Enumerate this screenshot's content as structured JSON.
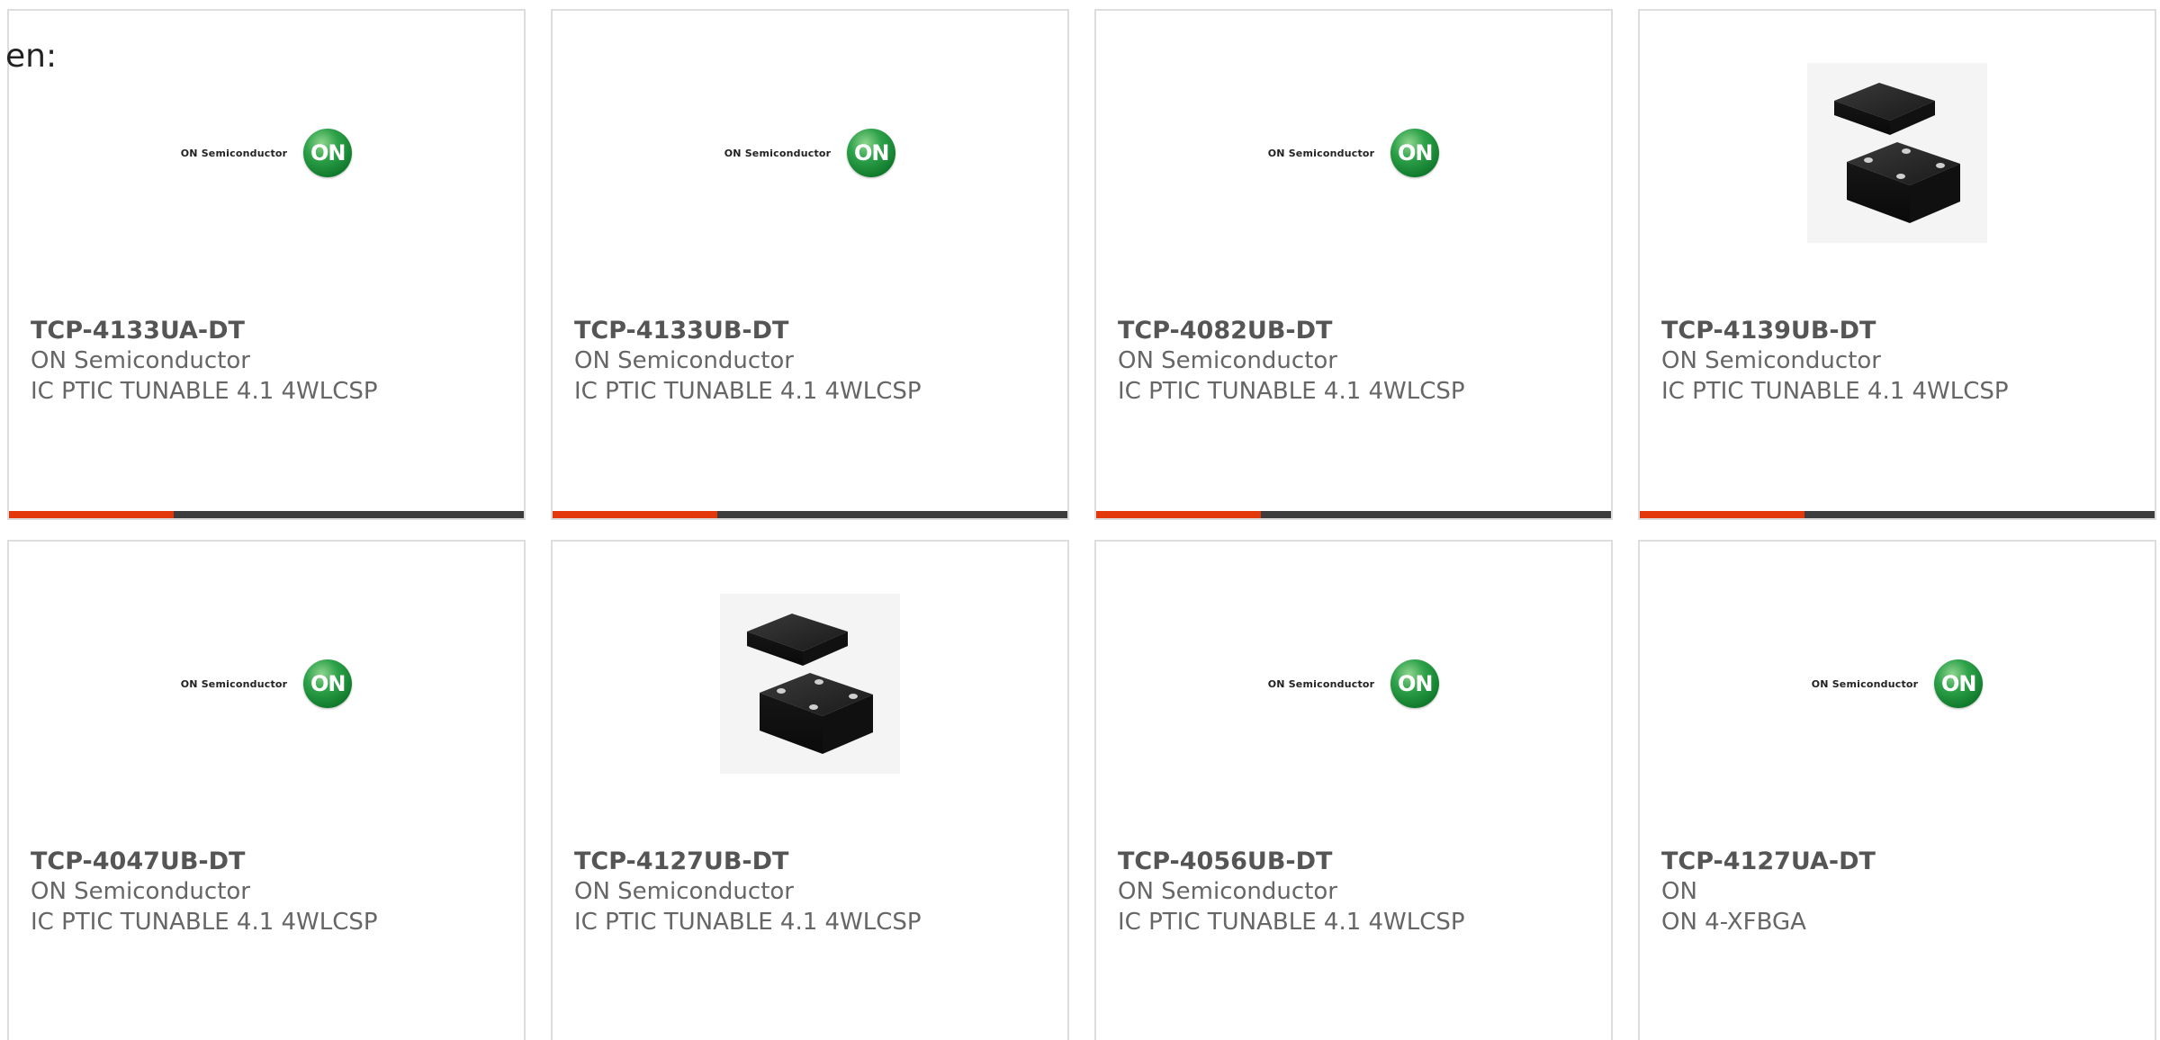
{
  "page_label": "en:",
  "colors": {
    "progress_fill": "#e2380c",
    "progress_track": "#3d3d3d",
    "card_border": "#dddddd",
    "logo_green": "#1f8f3a"
  },
  "products": [
    {
      "part_number": "TCP-4133UA-DT",
      "manufacturer": "ON Semiconductor",
      "description": "IC PTIC TUNABLE 4.1 4WLCSP",
      "image": "on-semiconductor-logo",
      "logo_text": "ON Semiconductor",
      "badge_text": "ON",
      "progress": 0.32
    },
    {
      "part_number": "TCP-4133UB-DT",
      "manufacturer": "ON Semiconductor",
      "description": "IC PTIC TUNABLE 4.1 4WLCSP",
      "image": "on-semiconductor-logo",
      "logo_text": "ON Semiconductor",
      "badge_text": "ON",
      "progress": 0.32
    },
    {
      "part_number": "TCP-4082UB-DT",
      "manufacturer": "ON Semiconductor",
      "description": "IC PTIC TUNABLE 4.1 4WLCSP",
      "image": "on-semiconductor-logo",
      "logo_text": "ON Semiconductor",
      "badge_text": "ON",
      "progress": 0.32
    },
    {
      "part_number": "TCP-4139UB-DT",
      "manufacturer": "ON Semiconductor",
      "description": "IC PTIC TUNABLE 4.1 4WLCSP",
      "image": "chip-package-photo",
      "progress": 0.32
    },
    {
      "part_number": "TCP-4047UB-DT",
      "manufacturer": "ON Semiconductor",
      "description": "IC PTIC TUNABLE 4.1 4WLCSP",
      "image": "on-semiconductor-logo",
      "logo_text": "ON Semiconductor",
      "badge_text": "ON"
    },
    {
      "part_number": "TCP-4127UB-DT",
      "manufacturer": "ON Semiconductor",
      "description": "IC PTIC TUNABLE 4.1 4WLCSP",
      "image": "chip-package-photo"
    },
    {
      "part_number": "TCP-4056UB-DT",
      "manufacturer": "ON Semiconductor",
      "description": "IC PTIC TUNABLE 4.1 4WLCSP",
      "image": "on-semiconductor-logo",
      "logo_text": "ON Semiconductor",
      "badge_text": "ON"
    },
    {
      "part_number": "TCP-4127UA-DT",
      "manufacturer": "ON",
      "description": "ON 4-XFBGA",
      "image": "on-semiconductor-logo",
      "logo_text": "ON Semiconductor",
      "badge_text": "ON"
    }
  ]
}
